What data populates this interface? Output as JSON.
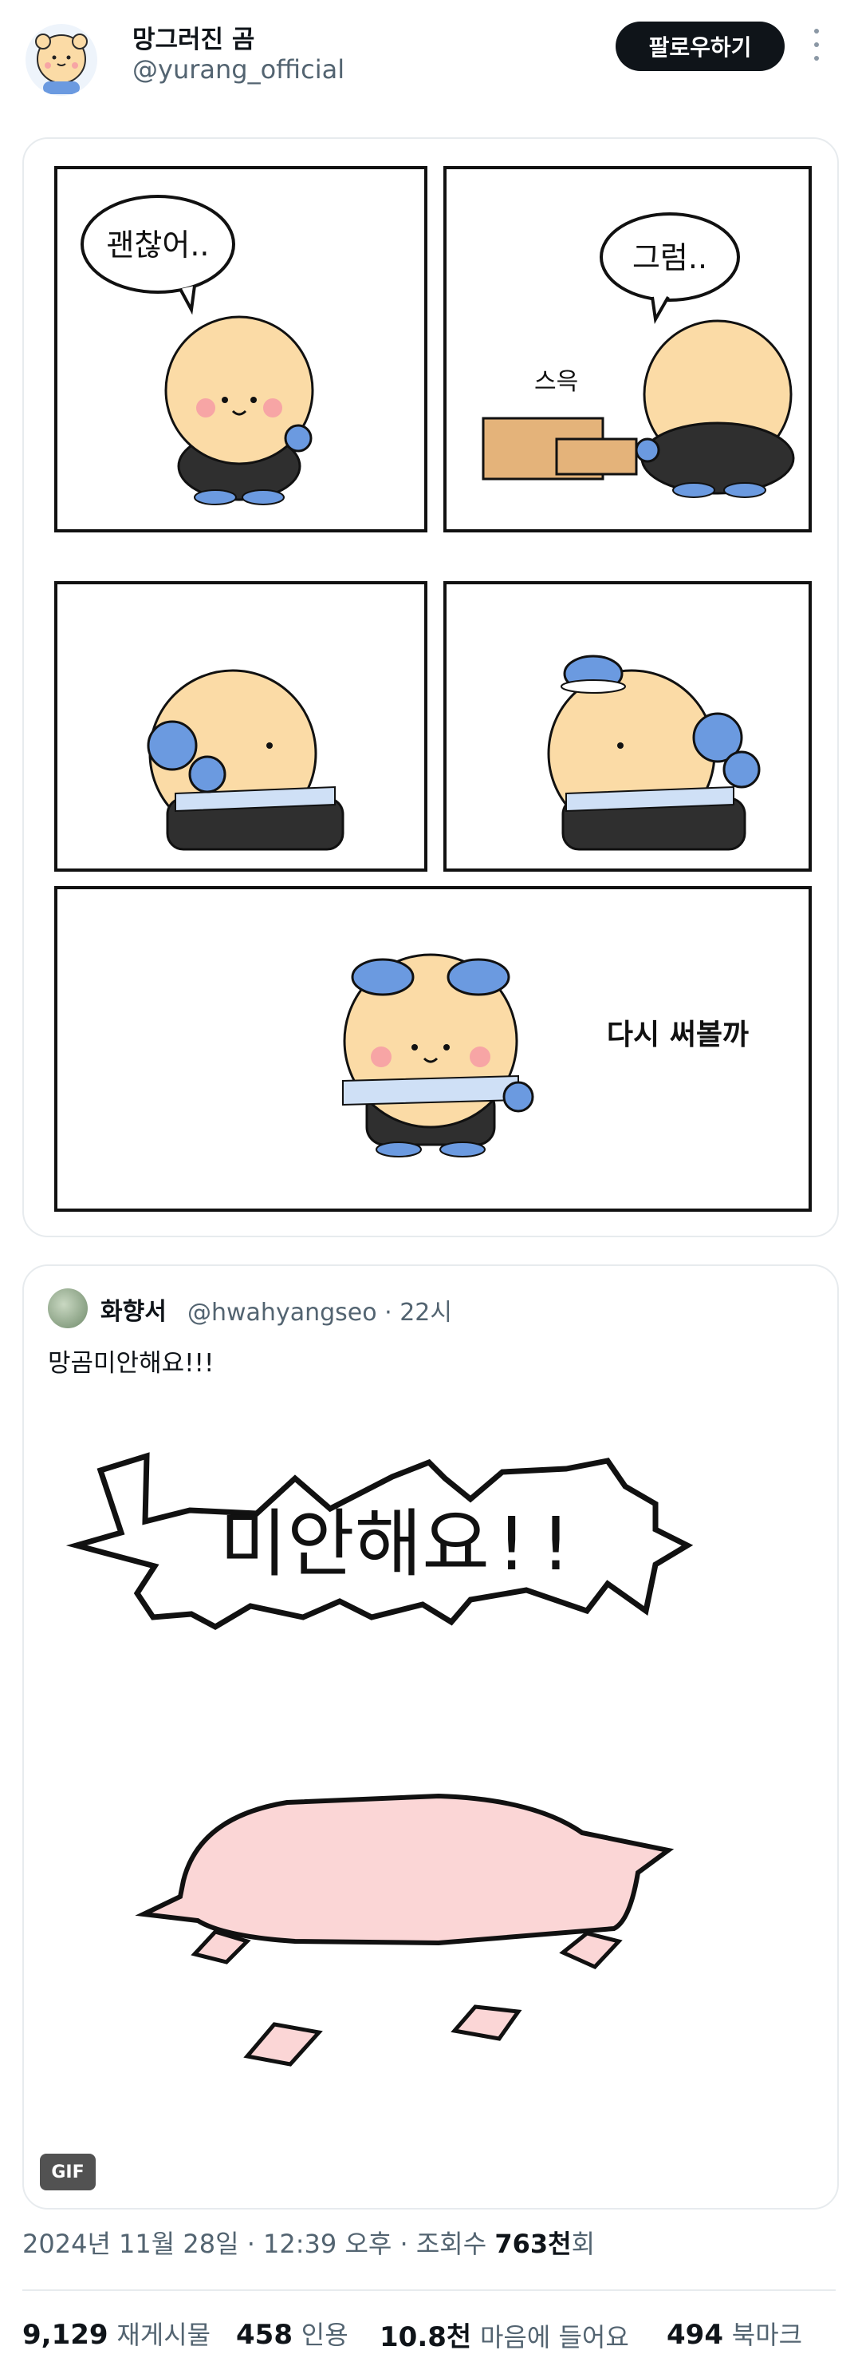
{
  "author": {
    "display_name": "망그러진 곰",
    "handle": "@yurang_official"
  },
  "follow_button": "팔로우하기",
  "comic": {
    "panels": [
      {
        "speech": "괜찮어.."
      },
      {
        "speech": "그럼..",
        "sound_effect": "스윽"
      },
      {},
      {},
      {
        "caption": "다시 써볼까"
      }
    ]
  },
  "quoted_post": {
    "display_name": "화향서",
    "handle": "@hwahyangseo",
    "time": "· 22시",
    "text": "망곰미안해요!!!",
    "gif_text": "미안해요!!",
    "gif_badge": "GIF"
  },
  "meta": {
    "date": "2024년 11월 28일 · 12:39 오후 · 조회수 ",
    "views": "763천",
    "views_unit": "회"
  },
  "stats": {
    "reposts_count": "9,129",
    "reposts_label": "재게시물",
    "quotes_count": "458",
    "quotes_label": "인용",
    "likes_count": "10.8천",
    "likes_label": "마음에 들어요",
    "bookmarks_count": "494",
    "bookmarks_label": "북마크"
  },
  "colors": {
    "text": "#0f1419",
    "muted": "#536471",
    "bear_fur": "#fbdba6",
    "bear_blue": "#6b9ae0",
    "pig_pink": "#fbd6d6",
    "border": "#e7ebee"
  }
}
